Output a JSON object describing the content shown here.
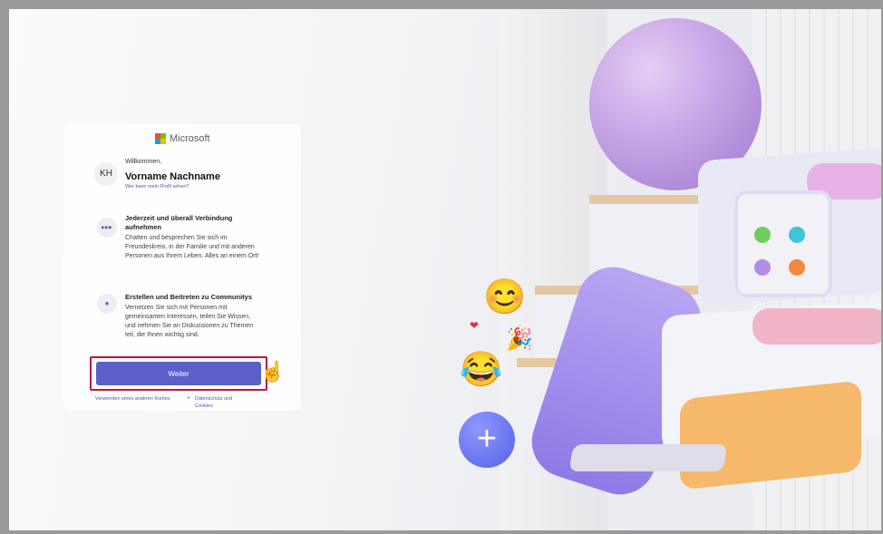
{
  "card": {
    "brand": "Microsoft",
    "welcome": "Willkommen,",
    "avatar_initials": "KH",
    "user_name": "Vorname Nachname",
    "profile_link": "Wer kann mein Profil sehen?",
    "features": [
      {
        "title": "Jederzeit und überall Verbindung aufnehmen",
        "text": "Chatten und besprechen Sie sich im Freundeskreis, in der Familie und mit anderen Personen aus Ihrem Leben. Alles an einem Ort!",
        "icon": "chat-bubble-icon"
      },
      {
        "title": "Erstellen und Beitreten zu Communitys",
        "text": "Vernetzen Sie sich mit Personen mit gemeinsamen Interessen, teilen Sie Wissen, und nehmen Sie an Diskussionen zu Themen teil, die Ihnen wichtig sind.",
        "icon": "community-people-icon"
      }
    ],
    "continue_label": "Weiter",
    "other_account_link": "Verwenden eines anderen Kontos",
    "privacy_link": "Datenschutz und Cookies"
  },
  "colors": {
    "accent": "#5b5fc7",
    "highlight_border": "#c0143c",
    "link": "#4b53bc"
  },
  "scene": {
    "plus_icon": "+",
    "emojis": [
      "😊",
      "😂",
      "❤",
      "🎉"
    ]
  }
}
